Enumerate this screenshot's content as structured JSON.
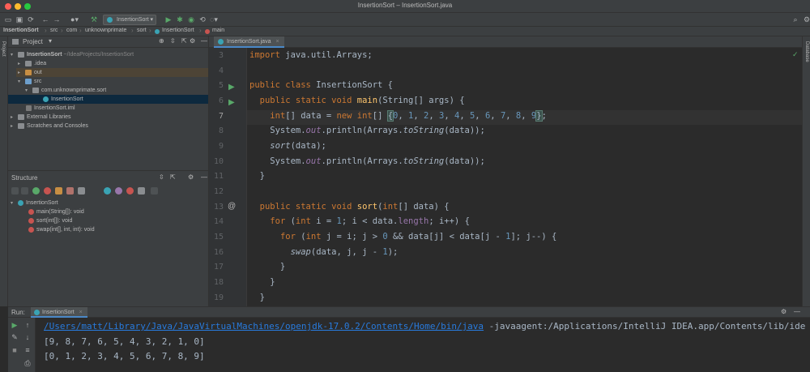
{
  "window": {
    "title": "InsertionSort – InsertionSort.java"
  },
  "colors": {
    "close": "#ff5f57",
    "minimize": "#febc2e",
    "maximize": "#28c840",
    "accent": "#4a88c7"
  },
  "toolbar": {
    "run_config": "InsertionSort"
  },
  "breadcrumb": [
    "InsertionSort",
    "src",
    "com",
    "unknownprimate",
    "sort",
    "InsertionSort",
    "main"
  ],
  "project": {
    "title": "Project",
    "tree": [
      {
        "label": "InsertionSort",
        "suffix": "~/IdeaProjects/InsertionSort"
      },
      {
        "label": ".idea"
      },
      {
        "label": "out"
      },
      {
        "label": "src"
      },
      {
        "label": "com.unknownprimate.sort"
      },
      {
        "label": "InsertionSort"
      },
      {
        "label": "InsertionSort.iml"
      },
      {
        "label": "External Libraries"
      },
      {
        "label": "Scratches and Consoles"
      }
    ]
  },
  "structure": {
    "title": "Structure",
    "items": [
      {
        "label": "InsertionSort"
      },
      {
        "label": "main(String[]): void"
      },
      {
        "label": "sort(int[]): void"
      },
      {
        "label": "swap(int[], int, int): void"
      }
    ]
  },
  "editor": {
    "tab": "InsertionSort.java",
    "line_numbers": [
      "3",
      "4",
      "5",
      "6",
      "7",
      "8",
      "9",
      "10",
      "11",
      "12",
      "13",
      "14",
      "15",
      "16",
      "17",
      "18",
      "19"
    ]
  },
  "sidebars": {
    "left_project": "Project",
    "left_structure": "Structure",
    "right_database": "Database"
  },
  "run": {
    "label": "Run:",
    "tab": "InsertionSort",
    "command_path": "/Users/matt/Library/Java/JavaVirtualMachines/openjdk-17.0.2/Contents/Home/bin/java",
    "command_args": " -javaagent:/Applications/IntelliJ IDEA.app/Contents/lib/ide",
    "output": [
      "[9, 8, 7, 6, 5, 4, 3, 2, 1, 0]",
      "[0, 1, 2, 3, 4, 5, 6, 7, 8, 9]"
    ]
  }
}
